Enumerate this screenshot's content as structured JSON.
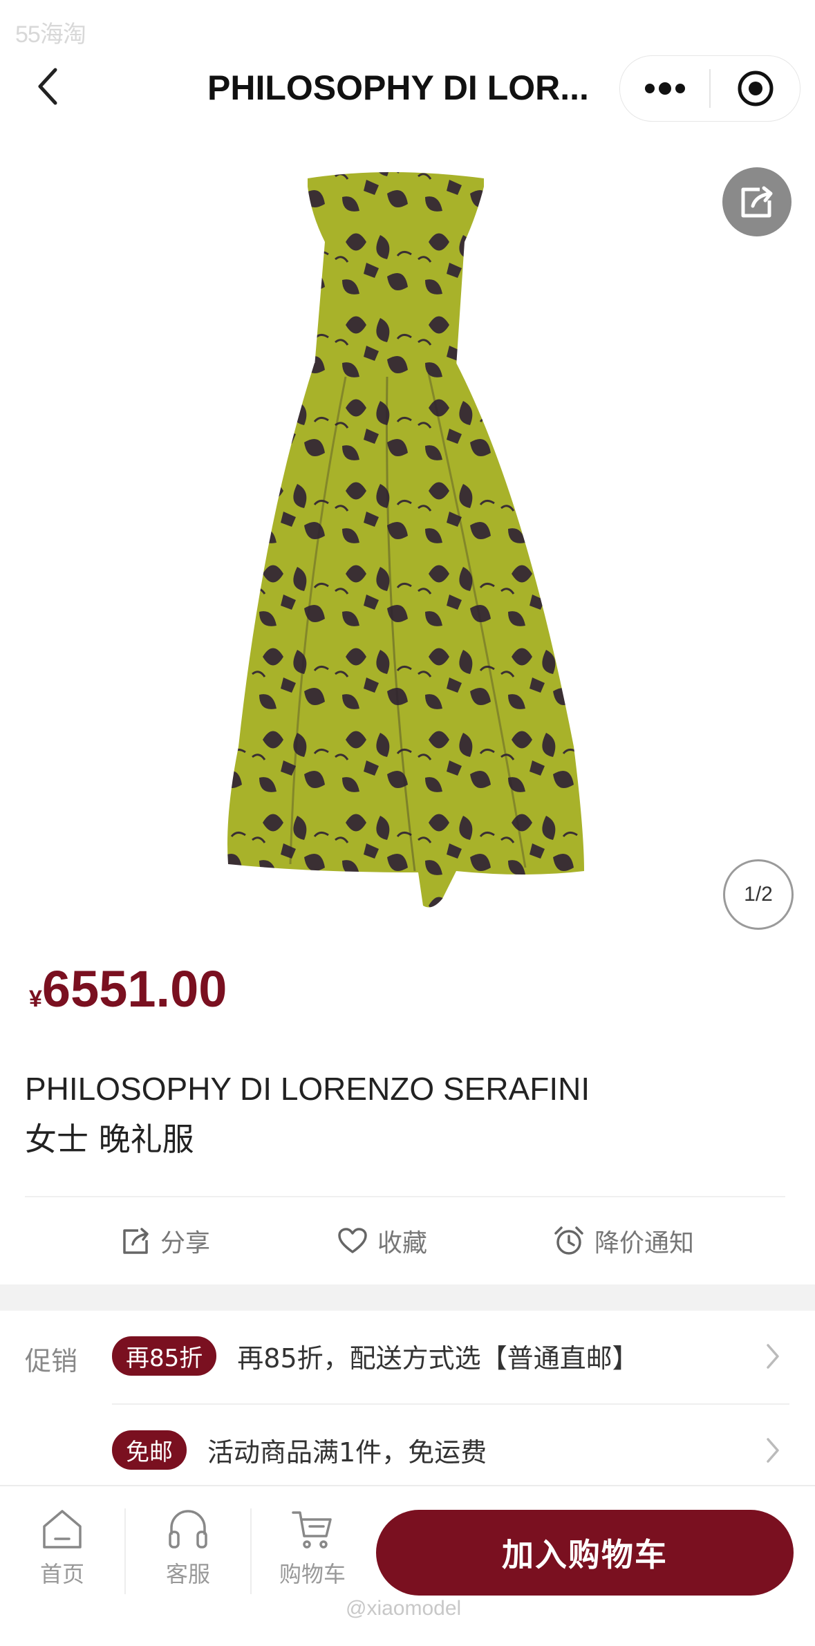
{
  "watermark_top": "55海淘",
  "navbar": {
    "title": "PHILOSOPHY DI LOR...",
    "back_icon": "chevron-left-icon",
    "more_icon": "more-dots-icon",
    "close_icon": "target-close-icon"
  },
  "gallery": {
    "share_icon": "share-icon",
    "pager": "1/2",
    "dress_colors": {
      "base": "#a8b22a",
      "print": "#3a2f33"
    }
  },
  "product": {
    "currency": "¥",
    "price": "6551.00",
    "title_line1": "PHILOSOPHY DI LORENZO SERAFINI",
    "title_line2": "女士 晚礼服"
  },
  "actions": [
    {
      "icon": "share-icon",
      "label": "分享"
    },
    {
      "icon": "heart-icon",
      "label": "收藏"
    },
    {
      "icon": "alarm-clock-icon",
      "label": "降价通知"
    }
  ],
  "promotions": {
    "label": "促销",
    "items": [
      {
        "tag": "再85折",
        "text": "再85折，配送方式选【普通直邮】"
      },
      {
        "tag": "免邮",
        "text": "活动商品满1件，免运费"
      }
    ]
  },
  "bottom_bar": {
    "tabs": [
      {
        "icon": "home-icon",
        "label": "首页"
      },
      {
        "icon": "headset-icon",
        "label": "客服"
      },
      {
        "icon": "cart-icon",
        "label": "购物车"
      }
    ],
    "add_to_cart": "加入购物车"
  },
  "watermark_bottom": "@xiaomodel",
  "colors": {
    "accent": "#7a1020",
    "muted": "#999999"
  }
}
